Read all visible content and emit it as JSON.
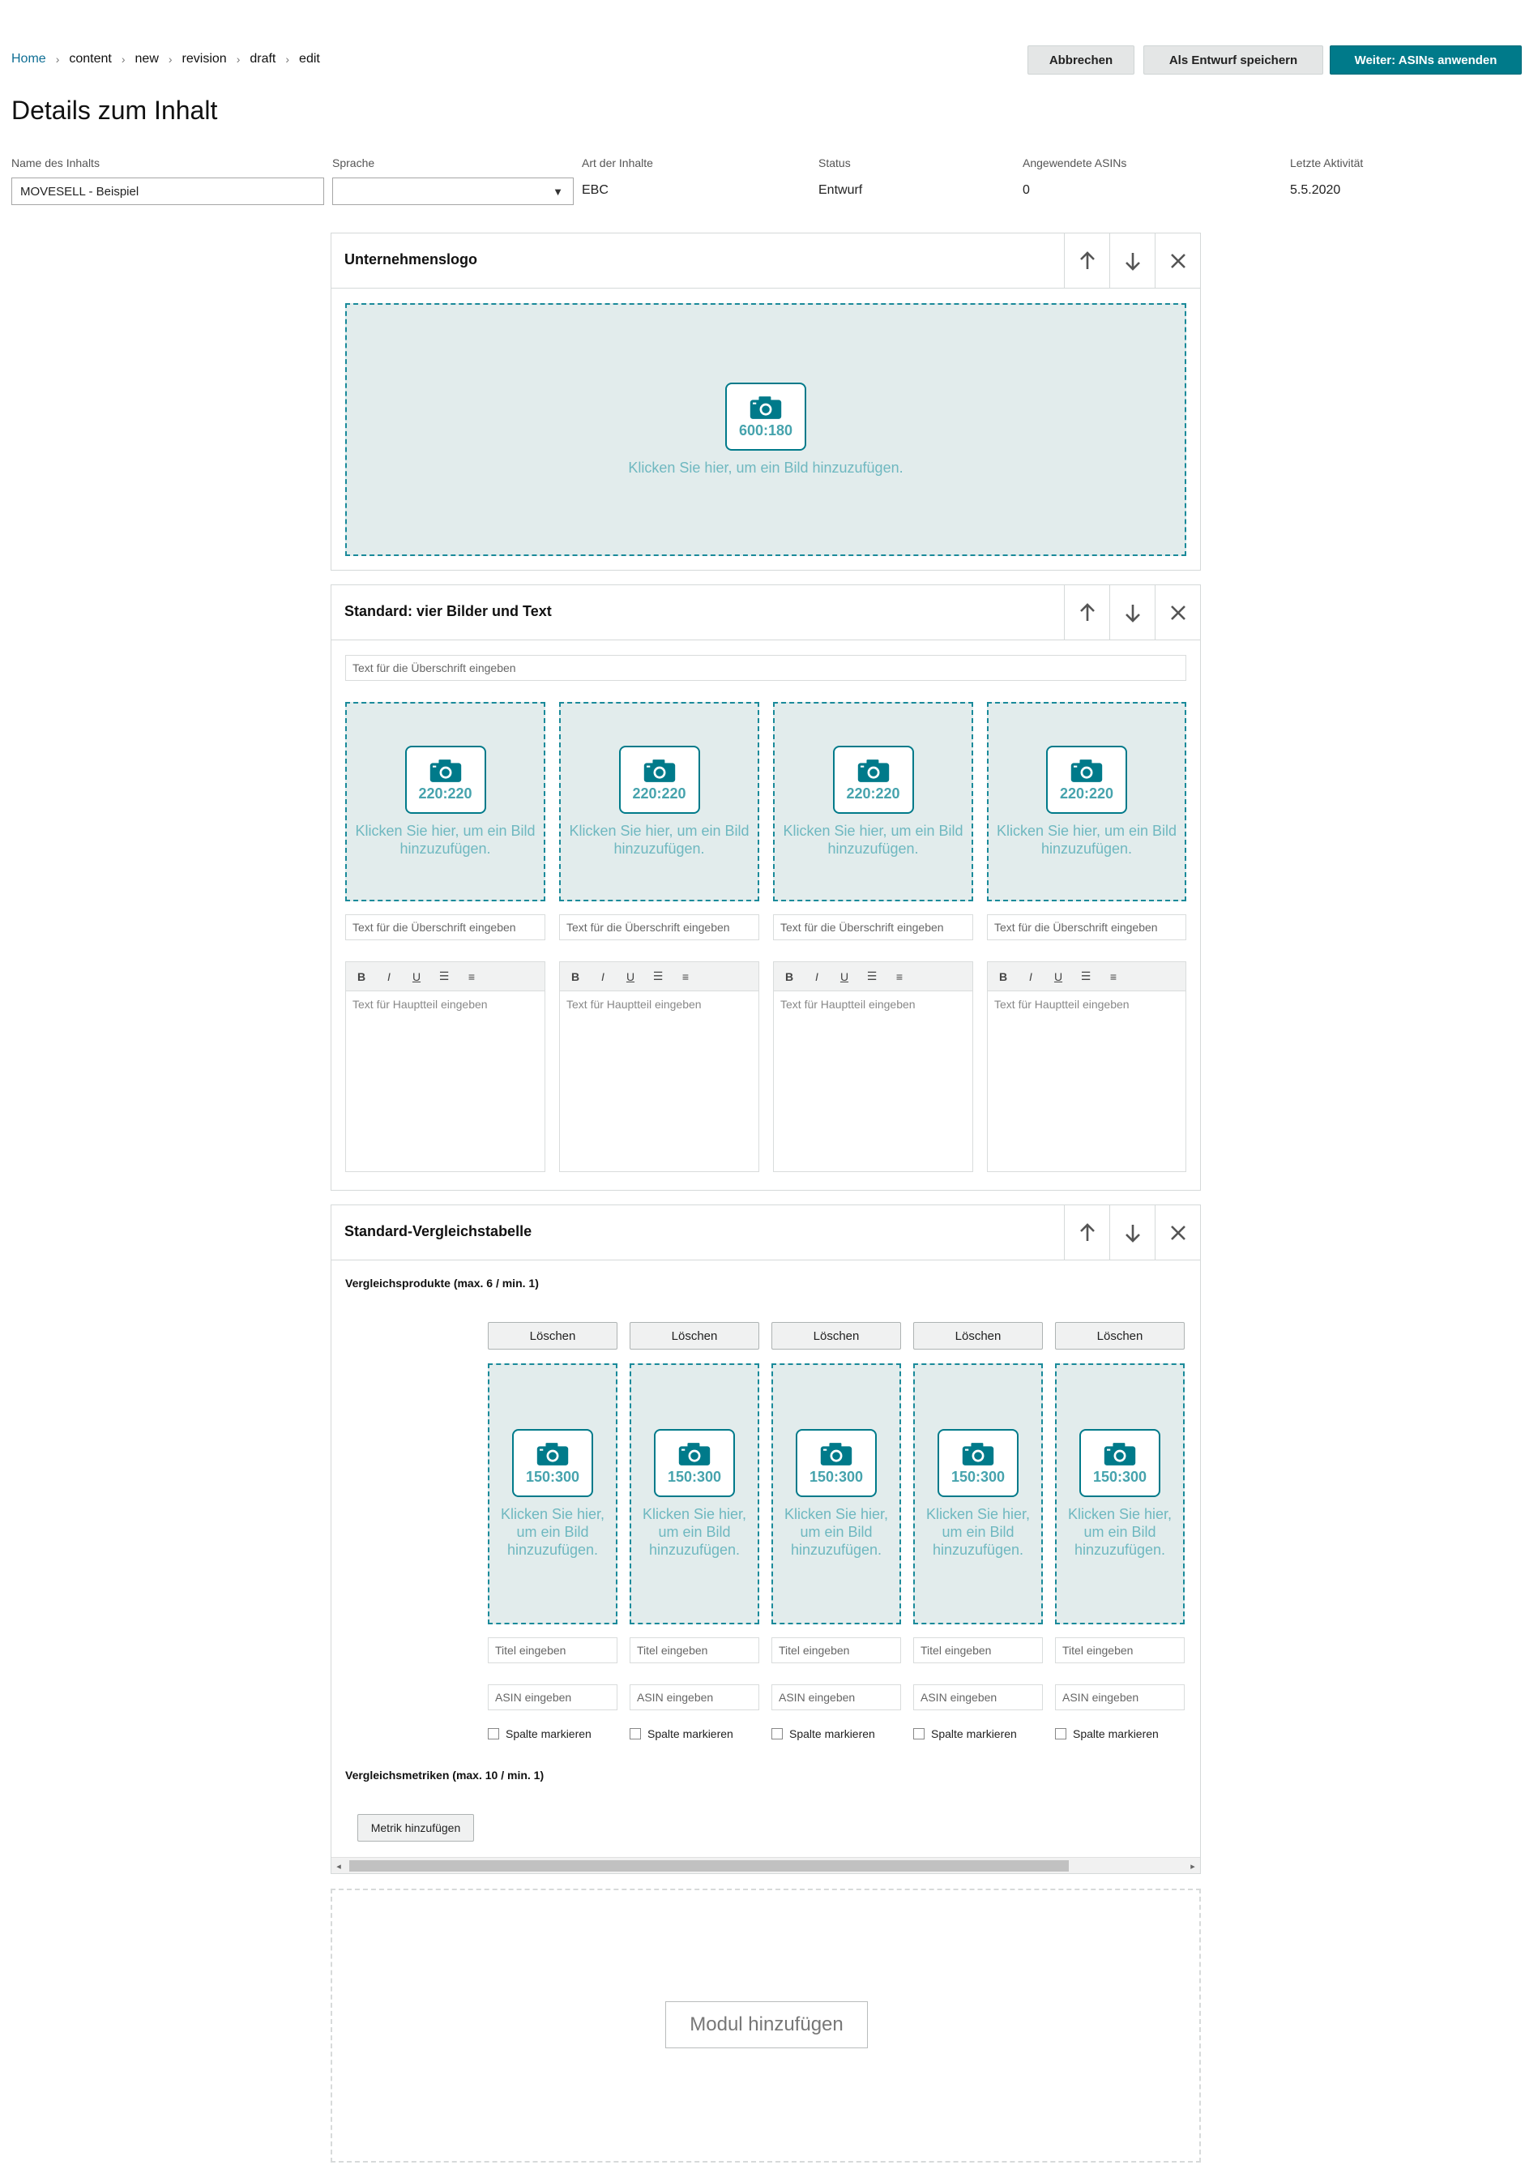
{
  "breadcrumb": [
    "Home",
    "content",
    "new",
    "revision",
    "draft",
    "edit"
  ],
  "actions": {
    "cancel": "Abbrechen",
    "save_draft": "Als Entwurf speichern",
    "next": "Weiter: ASINs anwenden"
  },
  "page_title": "Details zum Inhalt",
  "meta": {
    "name_label": "Name des Inhalts",
    "name_value": "MOVESELL - Beispiel",
    "language_label": "Sprache",
    "language_value": "",
    "type_label": "Art der Inhalte",
    "type_value": "EBC",
    "status_label": "Status",
    "status_value": "Entwurf",
    "asins_label": "Angewendete ASINs",
    "asins_value": "0",
    "activity_label": "Letzte Aktivität",
    "activity_value": "5.5.2020"
  },
  "module1": {
    "title": "Unternehmenslogo",
    "image_dim": "600:180",
    "image_text": "Klicken Sie hier, um ein Bild hinzuzufügen."
  },
  "module2": {
    "title": "Standard: vier Bilder und Text",
    "headline_placeholder": "Text für die Überschrift eingeben",
    "columns": [
      {
        "dim": "220:220",
        "text": "Klicken Sie hier, um ein Bild hinzuzufügen.",
        "headline": "Text für die Überschrift eingeben",
        "body": "Text für Hauptteil eingeben"
      },
      {
        "dim": "220:220",
        "text": "Klicken Sie hier, um ein Bild hinzuzufügen.",
        "headline": "Text für die Überschrift eingeben",
        "body": "Text für Hauptteil eingeben"
      },
      {
        "dim": "220:220",
        "text": "Klicken Sie hier, um ein Bild hinzuzufügen.",
        "headline": "Text für die Überschrift eingeben",
        "body": "Text für Hauptteil eingeben"
      },
      {
        "dim": "220:220",
        "text": "Klicken Sie hier, um ein Bild hinzuzufügen.",
        "headline": "Text für die Überschrift eingeben",
        "body": "Text für Hauptteil eingeben"
      }
    ],
    "toolbar": [
      "B",
      "I",
      "U",
      "☰",
      "≡"
    ]
  },
  "module3": {
    "title": "Standard-Vergleichstabelle",
    "products_label": "Vergleichsprodukte (max. 6 / min. 1)",
    "products": [
      {
        "delete": "Löschen",
        "dim": "150:300",
        "text": "Klicken Sie hier, um ein Bild hinzuzufügen.",
        "title_ph": "Titel eingeben",
        "asin_ph": "ASIN eingeben",
        "mark": "Spalte markieren"
      },
      {
        "delete": "Löschen",
        "dim": "150:300",
        "text": "Klicken Sie hier, um ein Bild hinzuzufügen.",
        "title_ph": "Titel eingeben",
        "asin_ph": "ASIN eingeben",
        "mark": "Spalte markieren"
      },
      {
        "delete": "Löschen",
        "dim": "150:300",
        "text": "Klicken Sie hier, um ein Bild hinzuzufügen.",
        "title_ph": "Titel eingeben",
        "asin_ph": "ASIN eingeben",
        "mark": "Spalte markieren"
      },
      {
        "delete": "Löschen",
        "dim": "150:300",
        "text": "Klicken Sie hier, um ein Bild hinzuzufügen.",
        "title_ph": "Titel eingeben",
        "asin_ph": "ASIN eingeben",
        "mark": "Spalte markieren"
      },
      {
        "delete": "Löschen",
        "dim": "150:300",
        "text": "Klicken Sie hier, um ein Bild hinzuzufügen.",
        "title_ph": "Titel eingeben",
        "asin_ph": "ASIN eingeben",
        "mark": "Spalte markieren"
      }
    ],
    "metrics_label": "Vergleichsmetriken (max. 10 / min. 1)",
    "add_metric": "Metrik hinzufügen"
  },
  "add_module": "Modul hinzufügen",
  "colors": {
    "accent": "#007a8a",
    "placeholder_bg": "#e2ecec",
    "dashed_border": "#1a8a9a",
    "link": "#0f6e94"
  }
}
